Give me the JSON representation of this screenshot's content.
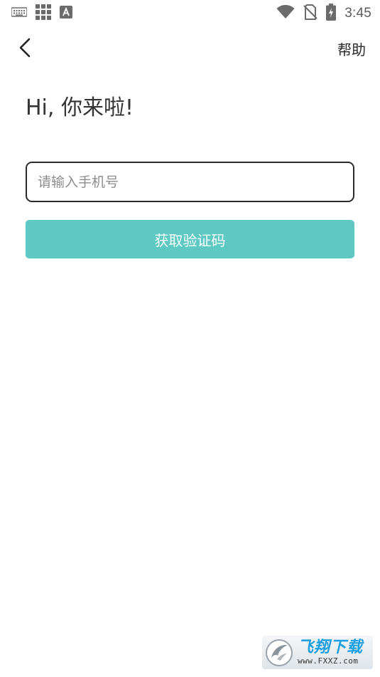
{
  "status_bar": {
    "time": "3:45",
    "icons": [
      "keyboard-icon",
      "grid-icon",
      "font-a-icon",
      "wifi-icon",
      "no-sim-icon",
      "battery-charging-icon"
    ]
  },
  "nav": {
    "back_icon": "chevron-left-icon",
    "help_label": "帮助"
  },
  "greeting": "Hi, 你来啦!",
  "phone_input": {
    "value": "",
    "placeholder": "请输入手机号"
  },
  "code_button": {
    "label": "获取验证码",
    "color": "#5ec8c3"
  },
  "watermark": {
    "title": "飞翔下载",
    "subtitle": "www.FXXZ.com"
  },
  "colors": {
    "accent": "#5ec8c3",
    "input_border": "#2b2b2b",
    "text": "#333333",
    "placeholder": "#8e8e8e"
  }
}
